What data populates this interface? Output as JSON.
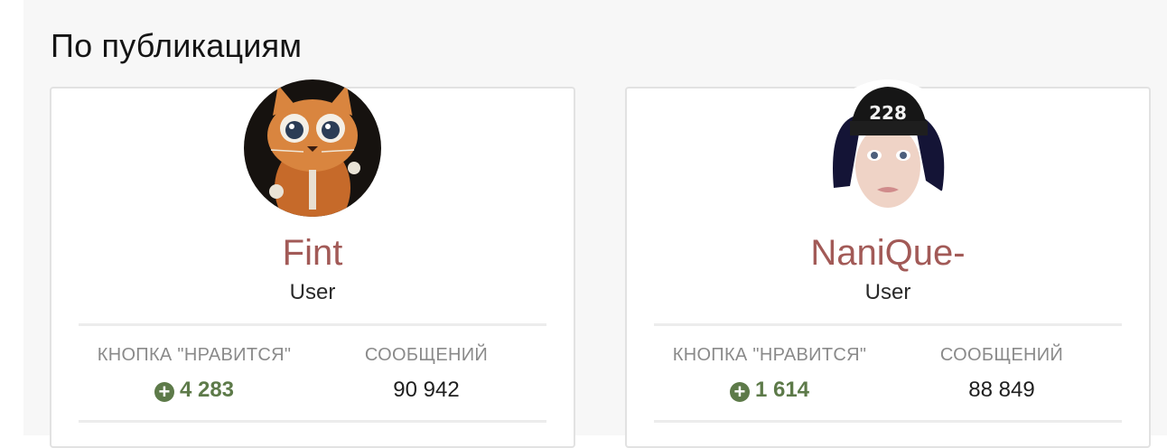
{
  "section": {
    "title": "По публикациям"
  },
  "users": [
    {
      "name": "Fint",
      "role": "User",
      "likes_label": "КНОПКА \"НРАВИТСЯ\"",
      "likes_value": "4 283",
      "posts_label": "СООБЩЕНИЙ",
      "posts_value": "90 942"
    },
    {
      "name": "NaniQue-",
      "role": "User",
      "likes_label": "КНОПКА \"НРАВИТСЯ\"",
      "likes_value": "1 614",
      "posts_label": "СООБЩЕНИЙ",
      "posts_value": "88 849"
    }
  ],
  "icons": {
    "likes": "plus-circle-icon"
  },
  "colors": {
    "username": "#a25a57",
    "likes": "#5d7a49"
  }
}
